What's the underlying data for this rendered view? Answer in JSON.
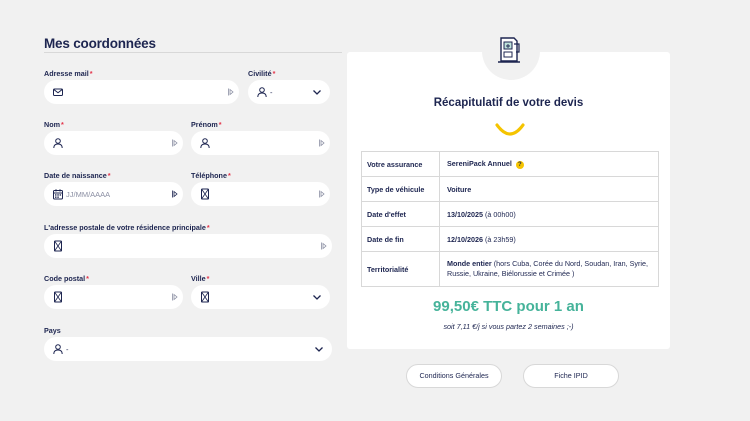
{
  "form": {
    "title": "Mes coordonnées",
    "email": {
      "label": "Adresse mail",
      "value": ""
    },
    "civilite": {
      "label": "Civilité",
      "value": "-"
    },
    "nom": {
      "label": "Nom",
      "value": ""
    },
    "prenom": {
      "label": "Prénom",
      "value": ""
    },
    "naissance": {
      "label": "Date de naissance",
      "placeholder": "JJ/MM/AAAA"
    },
    "telephone": {
      "label": "Téléphone",
      "value": ""
    },
    "adresse": {
      "label": "L'adresse postale de votre résidence principale",
      "value": ""
    },
    "code_postal": {
      "label": "Code postal",
      "value": ""
    },
    "ville": {
      "label": "Ville",
      "value": ""
    },
    "pays": {
      "label": "Pays",
      "value": "-"
    },
    "required_mark": "*"
  },
  "recap": {
    "title": "Récapitulatif de votre devis",
    "rows": [
      {
        "key": "Votre assurance",
        "value": "SereniPack Annuel",
        "extra": ""
      },
      {
        "key": "Type de véhicule",
        "value": "Voiture",
        "extra": ""
      },
      {
        "key": "Date d'effet",
        "value": "13/10/2025",
        "extra": "(à 00h00)"
      },
      {
        "key": "Date de fin",
        "value": "12/10/2026",
        "extra": "(à 23h59)"
      },
      {
        "key": "Territorialité",
        "value": "Monde entier",
        "extra": "(hors Cuba, Corée du Nord, Soudan, Iran, Syrie, Russie, Ukraine, Biélorussie et Crimée )"
      }
    ],
    "price": "99,50€ TTC pour 1 an",
    "per_day": "soit 7,11 €/j si vous partez 2 semaines ;-)",
    "help_icon_glyph": "?"
  },
  "actions": {
    "cg_label": "Conditions Générales",
    "ipid_label": "Fiche IPID"
  },
  "colors": {
    "navy": "#1d2550",
    "accent_green": "#46b39a",
    "required_red": "#e3344a",
    "smile_yellow": "#f5c400",
    "background": "#f1f1f1"
  },
  "icons": {
    "email": "envelope-icon",
    "person": "user-icon",
    "calendar": "calendar-icon",
    "address": "location-box-icon",
    "phone": "phone-icon",
    "chevron": "chevron-down-icon",
    "tab": "tab-arrow-icon",
    "machine": "vending-machine-icon",
    "smile": "smile-icon"
  }
}
